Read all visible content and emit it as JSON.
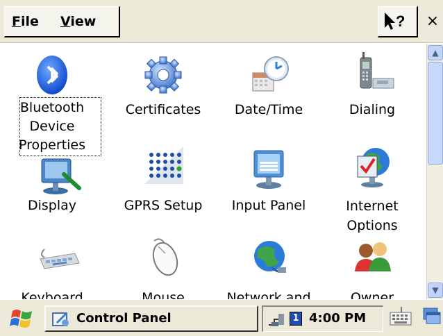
{
  "menu": {
    "file": "File",
    "view": "View"
  },
  "toolbar": {
    "help_label": "?",
    "close_label": "×"
  },
  "items": [
    {
      "label": "Bluetooth Device Properties",
      "icon": "bluetooth-icon"
    },
    {
      "label": "Certificates",
      "icon": "certificates-icon"
    },
    {
      "label": "Date/Time",
      "icon": "date-time-icon"
    },
    {
      "label": "Dialing",
      "icon": "dialing-icon"
    },
    {
      "label": "Display",
      "icon": "display-icon"
    },
    {
      "label": "GPRS Setup",
      "icon": "gprs-icon"
    },
    {
      "label": "Input Panel",
      "icon": "input-panel-icon"
    },
    {
      "label": "Internet Options",
      "icon": "internet-options-icon"
    },
    {
      "label": "Keyboard",
      "icon": "keyboard-icon"
    },
    {
      "label": "Mouse",
      "icon": "mouse-icon"
    },
    {
      "label": "Network and",
      "icon": "network-icon"
    },
    {
      "label": "Owner",
      "icon": "owner-icon"
    }
  ],
  "taskbar": {
    "task": "Control Panel",
    "tray_number": "1",
    "clock": "4:00 PM"
  }
}
